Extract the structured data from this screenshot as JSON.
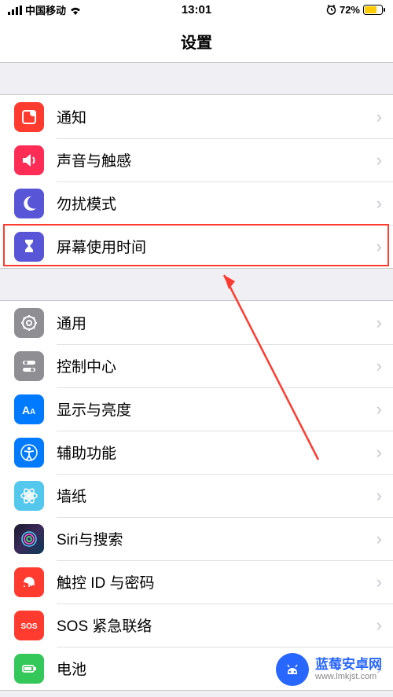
{
  "status": {
    "carrier": "中国移动",
    "time": "13:01",
    "battery_pct": "72%"
  },
  "header": {
    "title": "设置"
  },
  "groups": [
    {
      "rows": [
        {
          "key": "notif",
          "label": "通知"
        },
        {
          "key": "sound",
          "label": "声音与触感"
        },
        {
          "key": "dnd",
          "label": "勿扰模式"
        },
        {
          "key": "screentime",
          "label": "屏幕使用时间"
        }
      ]
    },
    {
      "rows": [
        {
          "key": "general",
          "label": "通用"
        },
        {
          "key": "control",
          "label": "控制中心"
        },
        {
          "key": "display",
          "label": "显示与亮度"
        },
        {
          "key": "access",
          "label": "辅助功能"
        },
        {
          "key": "wallpaper",
          "label": "墙纸"
        },
        {
          "key": "siri",
          "label": "Siri与搜索"
        },
        {
          "key": "touchid",
          "label": "触控 ID 与密码"
        },
        {
          "key": "sos",
          "label": "SOS 紧急联络"
        },
        {
          "key": "battery",
          "label": "电池"
        }
      ]
    }
  ],
  "highlight": {
    "target_row": "screentime"
  },
  "watermark": {
    "line1": "蓝莓安卓网",
    "line2": "www.lmkjst.com"
  }
}
